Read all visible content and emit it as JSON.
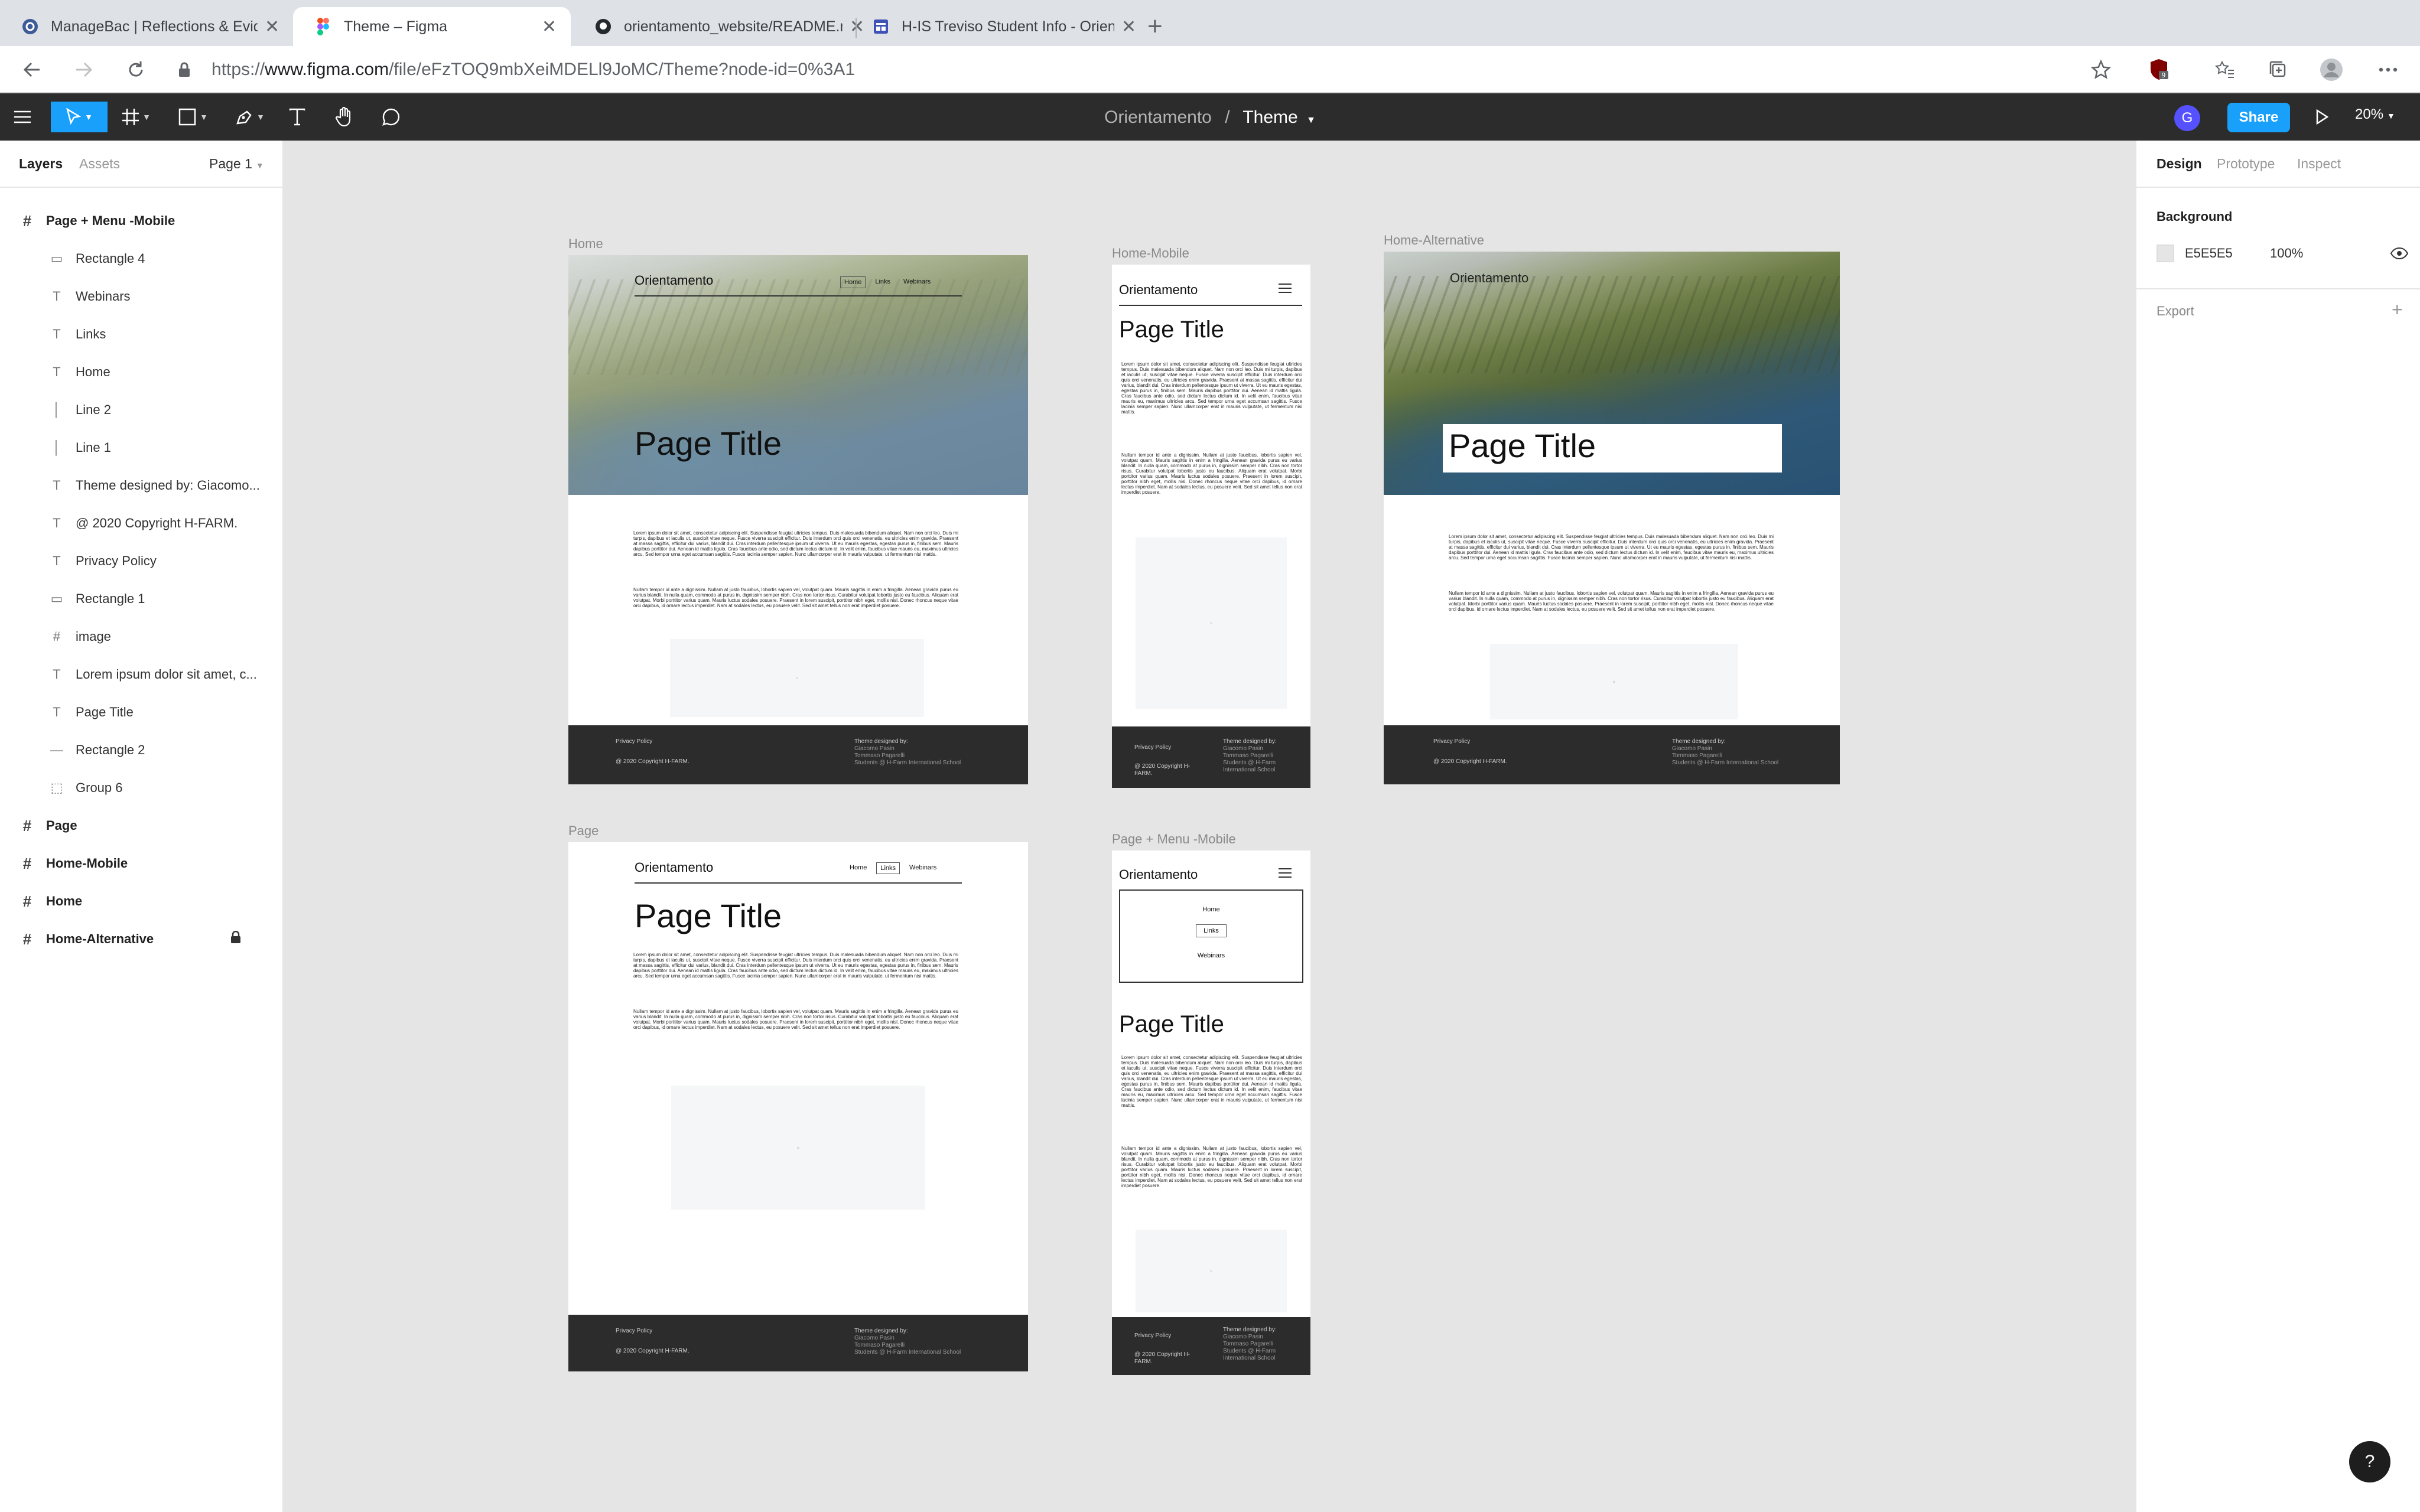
{
  "browser": {
    "tabs": [
      {
        "label": "ManageBac | Reflections & Evidence",
        "icon": "managebac-icon"
      },
      {
        "label": "Theme – Figma",
        "icon": "figma-icon",
        "active": true
      },
      {
        "label": "orientamento_website/README.md",
        "icon": "github-icon"
      },
      {
        "label": "H-IS Treviso Student Info - Orientamento",
        "icon": "sites-icon"
      }
    ],
    "url_prefix": "https://",
    "url_host": "www.figma.com",
    "url_path": "/file/eFzTOQ9mbXeiMDELl9JoMC/Theme?node-id=0%3A1",
    "extension_badge": "9"
  },
  "figma": {
    "project": "Orientamento",
    "separator": "/",
    "file": "Theme",
    "avatar": "G",
    "share_label": "Share",
    "zoom": "20%",
    "left_tabs": {
      "layers": "Layers",
      "assets": "Assets",
      "page": "Page 1"
    },
    "layers": [
      {
        "label": "Page + Menu -Mobile",
        "type": "frame",
        "icon": "frame-icon",
        "depth": 0
      },
      {
        "label": "Rectangle 4",
        "type": "rect",
        "icon": "rectangle-icon",
        "depth": 1
      },
      {
        "label": "Webinars",
        "type": "text",
        "icon": "text-icon",
        "depth": 1
      },
      {
        "label": "Links",
        "type": "text",
        "icon": "text-icon",
        "depth": 1
      },
      {
        "label": "Home",
        "type": "text",
        "icon": "text-icon",
        "depth": 1
      },
      {
        "label": "Line 2",
        "type": "line",
        "icon": "vertical-line-icon",
        "depth": 1
      },
      {
        "label": "Line 1",
        "type": "line",
        "icon": "vertical-line-icon",
        "depth": 1
      },
      {
        "label": "Theme designed by: Giacomo...",
        "type": "text",
        "icon": "text-icon",
        "depth": 1
      },
      {
        "label": "@ 2020 Copyright H-FARM.",
        "type": "text",
        "icon": "text-icon",
        "depth": 1
      },
      {
        "label": "Privacy Policy",
        "type": "text",
        "icon": "text-icon",
        "depth": 1
      },
      {
        "label": "Rectangle 1",
        "type": "rect",
        "icon": "rectangle-icon",
        "depth": 1
      },
      {
        "label": "image",
        "type": "frame",
        "icon": "frame-icon",
        "depth": 1
      },
      {
        "label": "Lorem ipsum dolor sit amet, c...",
        "type": "text",
        "icon": "text-icon",
        "depth": 1
      },
      {
        "label": "Page Title",
        "type": "text",
        "icon": "text-icon",
        "depth": 1
      },
      {
        "label": "Rectangle 2",
        "type": "line",
        "icon": "horizontal-line-icon",
        "depth": 1
      },
      {
        "label": "Group 6",
        "type": "group",
        "icon": "group-icon",
        "depth": 1
      },
      {
        "label": "Page",
        "type": "frame",
        "icon": "frame-icon",
        "depth": 0
      },
      {
        "label": "Home-Mobile",
        "type": "frame",
        "icon": "frame-icon",
        "depth": 0
      },
      {
        "label": "Home",
        "type": "frame",
        "icon": "frame-icon",
        "depth": 0
      },
      {
        "label": "Home-Alternative",
        "type": "frame",
        "icon": "frame-icon",
        "depth": 0,
        "locked": true
      }
    ],
    "right_tabs": {
      "design": "Design",
      "prototype": "Prototype",
      "inspect": "Inspect"
    },
    "background": {
      "title": "Background",
      "hex": "E5E5E5",
      "opacity": "100%",
      "swatch_color": "#E5E5E5"
    },
    "export_title": "Export",
    "help": "?"
  },
  "canvas": {
    "site_name": "Orientamento",
    "page_title": "Page Title",
    "nav": {
      "home": "Home",
      "links": "Links",
      "webinars": "Webinars"
    },
    "lorem_1": "Lorem ipsum dolor sit amet, consectetur adipiscing elit. Suspendisse feugiat ultricies tempus. Duis malesuada bibendum aliquet. Nam non orci leo. Duis mi turpis, dapibus et iaculis ut, suscipit vitae neque. Fusce viverra suscipit efficitur. Duis interdum orci quis orci venenatis, eu ultricies enim gravida. Praesent at massa sagittis, efficitur dui varius, blandit dui. Cras interdum pellentesque ipsum ut viverra. Ut eu mauris egestas, egestas purus in, finibus sem. Mauris dapibus porttitor dui. Aenean id mattis ligula. Cras faucibus ante odio, sed dictum lectus dictum id. In velit enim, faucibus vitae mauris eu, maximus ultricies arcu. Sed tempor urna eget accumsan sagittis. Fusce lacinia semper sapien. Nunc ullamcorper erat in mauris vulputate, ut fermentum nisi mattis.",
    "lorem_2": "Nullam tempor id ante a dignissim. Nullam at justo faucibus, lobortis sapien vel, volutpat quam. Mauris sagittis in enim a fringilla. Aenean gravida purus eu varius blandit. In nulla quam, commodo at purus in, dignissim semper nibh. Cras non tortor risus. Curabitur volutpat lobortis justo eu faucibus. Aliquam erat volutpat. Morbi porttitor varius quam. Mauris luctus sodales posuere. Praesent in lorem suscipit, porttitor nibh eget, mollis nisl. Donec rhoncus neque vitae orci dapibus, id ornare lectus imperdiet. Nam at sodales lectus, eu posuere velit. Sed sit amet tellus non erat imperdiet posuere.",
    "footer": {
      "privacy": "Privacy Policy",
      "copyright": "@ 2020 Copyright H-FARM.",
      "designed_by": "Theme designed by:",
      "designers": "Giacomo Pasin",
      "designers2": "Tommaso Pagarelli",
      "school": "Students @ H-Farm International School"
    },
    "frames": {
      "home": "Home",
      "home_mobile": "Home-Mobile",
      "home_alt": "Home-Alternative",
      "page": "Page",
      "page_menu_mobile": "Page + Menu -Mobile"
    }
  }
}
